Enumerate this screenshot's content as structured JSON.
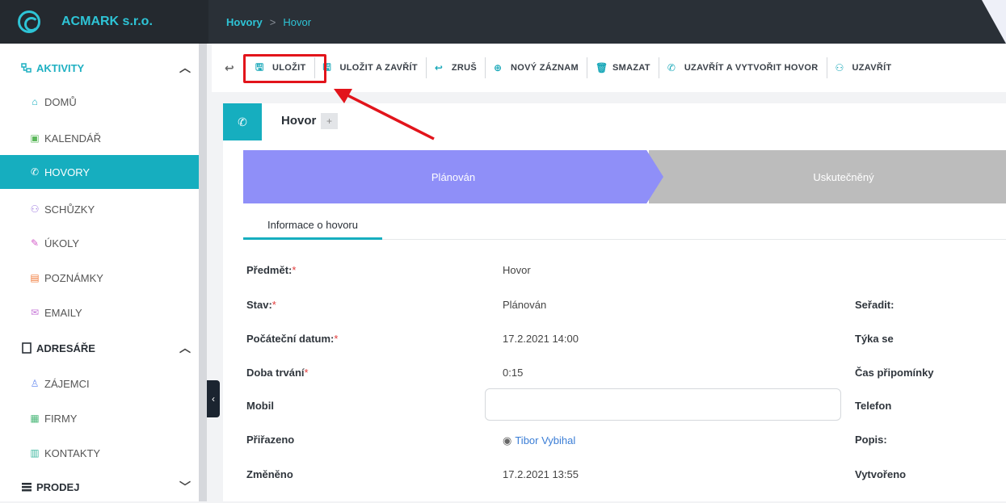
{
  "header": {
    "brand": "ACMARK s.r.o.",
    "breadcrumb": [
      "Hovory",
      "Hovor"
    ],
    "breadcrumb_separator": ">"
  },
  "sidebar": {
    "sections": [
      {
        "label": "AKTIVITY",
        "icon": "activities-icon",
        "expanded": true,
        "items": [
          {
            "label": "DOMŮ",
            "icon": "home-icon"
          },
          {
            "label": "KALENDÁŘ",
            "icon": "calendar-icon"
          },
          {
            "label": "HOVORY",
            "icon": "phone-icon",
            "active": true
          },
          {
            "label": "SCHŮZKY",
            "icon": "meeting-icon"
          },
          {
            "label": "ÚKOLY",
            "icon": "task-icon"
          },
          {
            "label": "POZNÁMKY",
            "icon": "note-icon"
          },
          {
            "label": "EMAILY",
            "icon": "email-icon"
          }
        ]
      },
      {
        "label": "ADRESÁŘE",
        "icon": "address-book-icon",
        "expanded": true,
        "items": [
          {
            "label": "ZÁJEMCI",
            "icon": "prospect-icon"
          },
          {
            "label": "FIRMY",
            "icon": "company-icon"
          },
          {
            "label": "KONTAKTY",
            "icon": "contact-icon"
          }
        ]
      },
      {
        "label": "PRODEJ",
        "icon": "sales-icon",
        "expanded": false,
        "items": []
      }
    ]
  },
  "toolbar": {
    "buttons": [
      {
        "label": "ULOŽIT",
        "icon": "save-icon",
        "highlighted": true
      },
      {
        "label": "ULOŽIT A ZAVŘÍT",
        "icon": "save-close-icon"
      },
      {
        "label": "ZRUŠ",
        "icon": "undo-icon"
      },
      {
        "label": "NOVÝ ZÁZNAM",
        "icon": "plus-circle-icon"
      },
      {
        "label": "SMAZAT",
        "icon": "trash-icon"
      },
      {
        "label": "UZAVŘÍT A VYTVOŘIT HOVOR",
        "icon": "phone-icon"
      },
      {
        "label": "UZAVŘÍT",
        "icon": "meeting-icon"
      }
    ]
  },
  "record": {
    "title": "Hovor",
    "add_label": "+",
    "stages": [
      "Plánován",
      "Uskutečněný"
    ],
    "active_stage": "Plánován",
    "tab": "Informace o hovoru",
    "left_fields": [
      {
        "label": "Předmět:",
        "required": true,
        "value": "Hovor"
      },
      {
        "label": "Stav:",
        "required": true,
        "value": "Plánován"
      },
      {
        "label": "Počáteční datum:",
        "required": true,
        "value": "17.2.2021 14:00"
      },
      {
        "label": "Doba trvání",
        "required": true,
        "value": "0:15"
      },
      {
        "label": "Mobil",
        "required": false,
        "value": ""
      },
      {
        "label": "Přiřazeno",
        "required": false,
        "value": "Tibor Vybihal"
      },
      {
        "label": "Změněno",
        "required": false,
        "value": "17.2.2021 13:55"
      }
    ],
    "right_fields": [
      "Seřadit:",
      "Týka se",
      "Čas připomínky",
      "Telefon",
      "Popis:",
      "Vytvořeno"
    ]
  },
  "colors": {
    "accent": "#16aebf",
    "stage_active": "#8f8ff8",
    "stage_inactive": "#bcbcbc",
    "highlight": "#e2141b"
  }
}
